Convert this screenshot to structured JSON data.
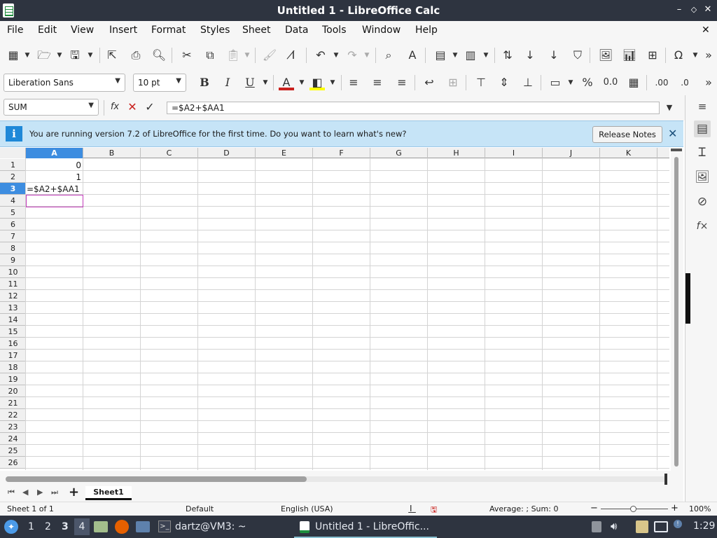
{
  "window": {
    "title": "Untitled 1 - LibreOffice Calc",
    "minimize": "–",
    "maximize": "◇",
    "close": "✕"
  },
  "menubar": {
    "items": [
      "File",
      "Edit",
      "View",
      "Insert",
      "Format",
      "Styles",
      "Sheet",
      "Data",
      "Tools",
      "Window",
      "Help"
    ],
    "close": "✕"
  },
  "toolbar2": {
    "font_name": "Liberation Sans",
    "font_size": "10 pt"
  },
  "formula_bar": {
    "name_box": "SUM",
    "formula": "=$A2+$AA1",
    "fx_label": "fx",
    "cancel": "✕",
    "accept": "✓"
  },
  "infobar": {
    "message": "You are running version 7.2 of LibreOffice for the first time. Do you want to learn what's new?",
    "button": "Release Notes",
    "close": "✕"
  },
  "grid": {
    "columns": [
      "A",
      "B",
      "C",
      "D",
      "E",
      "F",
      "G",
      "H",
      "I",
      "J",
      "K"
    ],
    "rows": [
      "1",
      "2",
      "3",
      "4",
      "5",
      "6",
      "7",
      "8",
      "9",
      "10",
      "11",
      "12",
      "13",
      "14",
      "15",
      "16",
      "17",
      "18",
      "19",
      "20",
      "21",
      "22",
      "23",
      "24",
      "25",
      "26"
    ],
    "active_column": "A",
    "active_row": "3",
    "cells": {
      "A1": "0",
      "A2": "1",
      "A3": "=$A2+$AA1"
    }
  },
  "sheet_tabs": {
    "tabs": [
      "Sheet1"
    ],
    "add": "+"
  },
  "statusbar": {
    "sheet_pos": "Sheet 1 of 1",
    "page_style": "Default",
    "language": "English (USA)",
    "sum_text": "Average: ; Sum: 0",
    "zoom": "100%",
    "zoom_minus": "−",
    "zoom_plus": "+"
  },
  "taskbar": {
    "workspaces": [
      "1",
      "2",
      "3",
      "4"
    ],
    "terminal": "dartz@VM3: ~",
    "calc_task": "Untitled 1 - LibreOffic...",
    "clock": "1:29"
  },
  "colors": {
    "titlebar": "#2e3440",
    "infobar": "#c6e4f7",
    "selection": "#3d8de0",
    "cursor": "#c23bba"
  }
}
